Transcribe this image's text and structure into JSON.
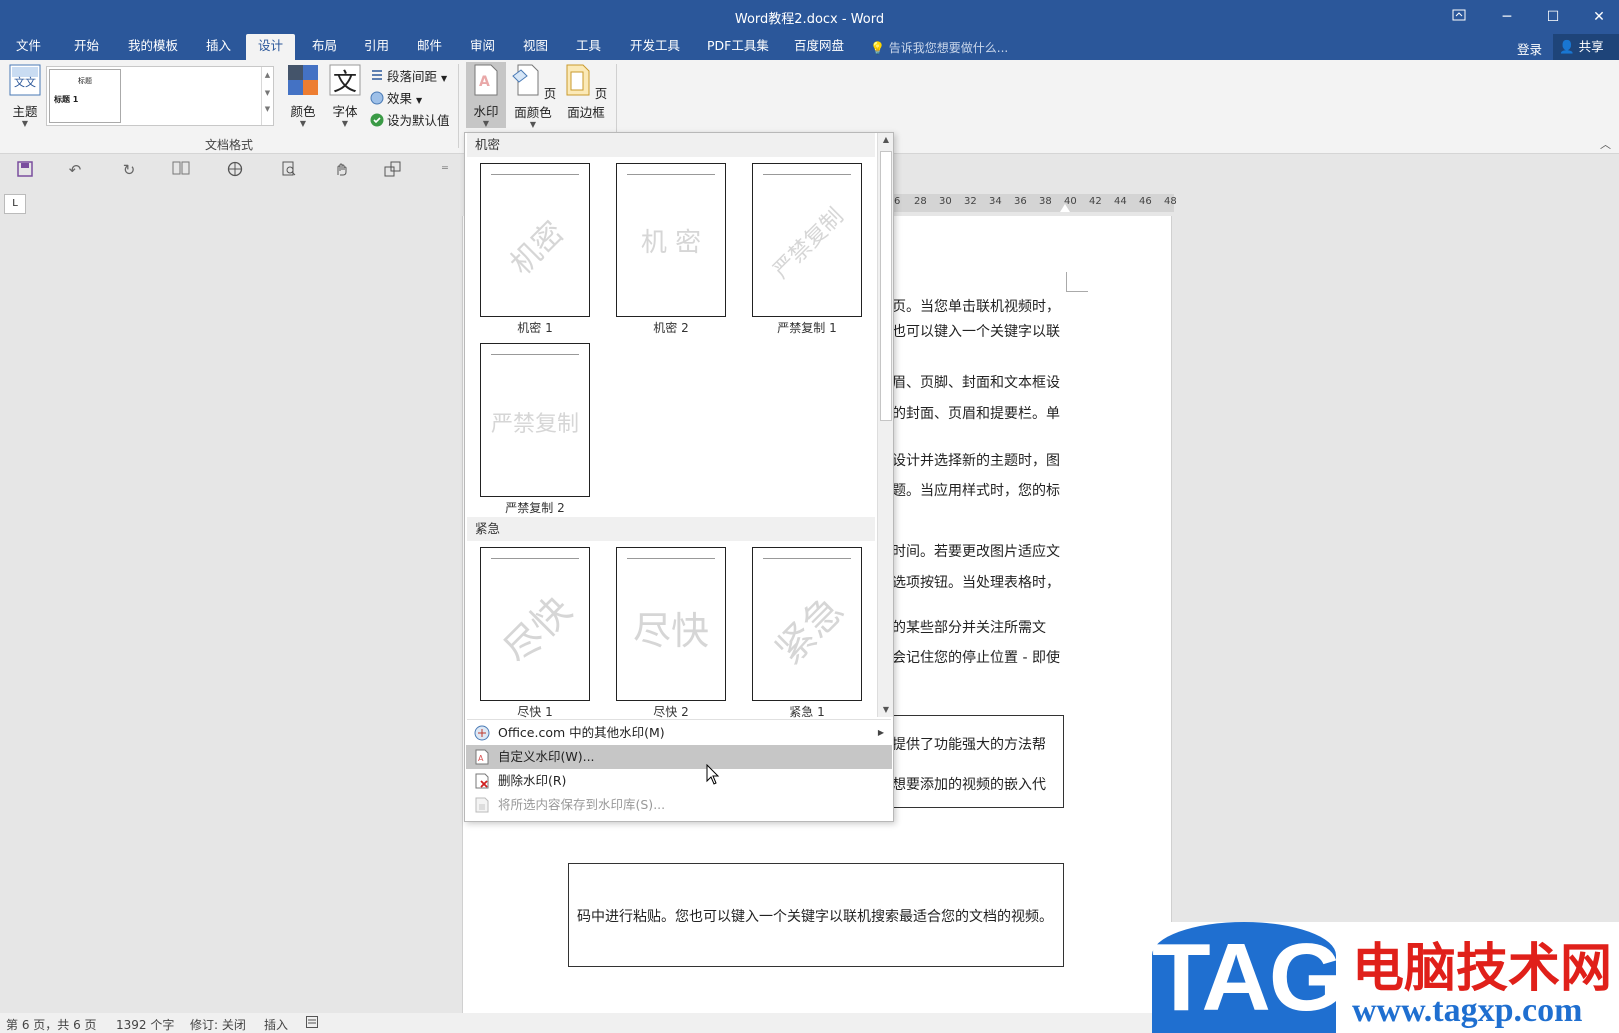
{
  "window": {
    "title": "Word教程2.docx - Word",
    "restore_icon": "ribbon-display-icon",
    "min": "─",
    "max": "☐",
    "close": "✕"
  },
  "tabs": [
    "文件",
    "开始",
    "我的模板",
    "插入",
    "设计",
    "布局",
    "引用",
    "邮件",
    "审阅",
    "视图",
    "工具",
    "开发工具",
    "PDF工具集",
    "百度网盘"
  ],
  "active_tab": "设计",
  "tell_me": "告诉我您想要做什么...",
  "account": {
    "login": "登录",
    "share": "共享"
  },
  "ribbon": {
    "theme_label": "主题",
    "style_thumb_title": "标题",
    "style_thumb_heading": "标题 1",
    "colors_label": "颜色",
    "fonts_label": "字体",
    "para_spacing_label": "段落间距",
    "effects_label": "效果",
    "set_default_label": "设为默认值",
    "group_label": "文档格式",
    "watermark_label": "水印",
    "page_color_label": "页面颜色",
    "page_border_label": "页面边框"
  },
  "ruler_ticks": [
    "6",
    "28",
    "30",
    "32",
    "34",
    "36",
    "38",
    "40",
    "42",
    "44",
    "46",
    "48"
  ],
  "tab_selector": "L",
  "document": {
    "lines": [
      "页。当您单击联机视频时，",
      "也可以键入一个关键字以联",
      "眉、页脚、封面和文本框设",
      "的封面、页眉和提要栏。单",
      "设计并选择新的主题时，图",
      "题。当应用样式时，您的标",
      "时间。若要更改图片适应文",
      "选项按钮。当处理表格时，",
      "的某些部分并关注所需文",
      "会记住您的停止位置 - 即使"
    ],
    "box1_lines": [
      "提供了功能强大的方法帮",
      "想要添加的视频的嵌入代"
    ],
    "box2_line": "码中进行粘贴。您也可以键入一个关键字以联机搜索最适合您的文档的视频。"
  },
  "watermark_menu": {
    "categories": [
      "机密",
      "紧急"
    ],
    "items": [
      {
        "caption": "机密 1",
        "text": "机密",
        "diagonal": true
      },
      {
        "caption": "机密 2",
        "text": "机 密",
        "diagonal": false
      },
      {
        "caption": "严禁复制 1",
        "text": "严禁复制",
        "diagonal": true
      },
      {
        "caption": "严禁复制 2",
        "text": "严禁复制",
        "diagonal": false
      },
      {
        "caption": "尽快 1",
        "text": "尽快",
        "diagonal": true
      },
      {
        "caption": "尽快 2",
        "text": "尽快",
        "diagonal": false
      },
      {
        "caption": "紧急 1",
        "text": "紧急",
        "diagonal": true
      }
    ],
    "commands": [
      {
        "label": "Office.com 中的其他水印(M)",
        "icon": "office-online-icon",
        "highlighted": false,
        "disabled": false,
        "submenu": true
      },
      {
        "label": "自定义水印(W)...",
        "icon": "custom-watermark-icon",
        "highlighted": true,
        "disabled": false,
        "submenu": false
      },
      {
        "label": "删除水印(R)",
        "icon": "remove-watermark-icon",
        "highlighted": false,
        "disabled": false,
        "submenu": false
      },
      {
        "label": "将所选内容保存到水印库(S)...",
        "icon": "save-to-gallery-icon",
        "highlighted": false,
        "disabled": true,
        "submenu": false
      }
    ]
  },
  "status": {
    "page": "第 6 页，共 6 页",
    "words": "1392 个字",
    "track": "修订: 关闭",
    "mode": "插入"
  },
  "logo": {
    "tag": "TAG",
    "cn": "电脑技术网",
    "url": "www.tagxp.com"
  },
  "colors": {
    "accent": "#2b579a",
    "highlight": "#c6c6c6",
    "logo_blue": "#1f6fd0",
    "logo_red": "#e0201a"
  }
}
